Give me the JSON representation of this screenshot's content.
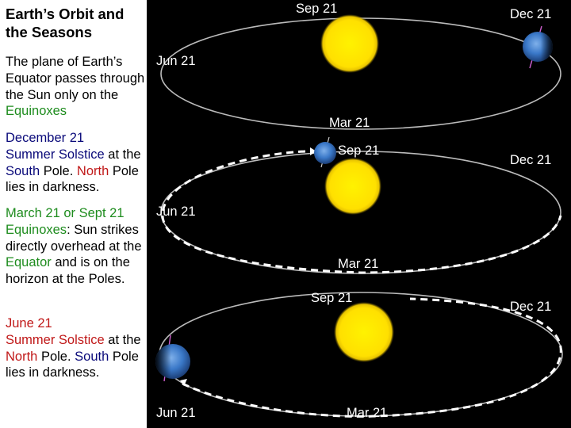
{
  "title": "Earth’s Orbit and the Seasons",
  "paragraphs": {
    "equator_plane": {
      "part1": "The plane of Earth’s Equator passes through the Sun only on the ",
      "equinoxes": "Equinoxes"
    },
    "december": {
      "date": "December 21",
      "solstice": "Summer Solstice",
      "at": " at the ",
      "pole": "South",
      "pole_suffix": " Pole. ",
      "dark_pole": "North",
      "dark_suffix": " Pole lies in darkness."
    },
    "equinox": {
      "date": "March 21 or Sept 21",
      "equinoxes": "Equinoxes",
      "text1": ": Sun strikes directly overhead at the ",
      "equator": "Equator",
      "text2": " and is on the horizon at the Poles."
    },
    "june": {
      "date": "June 21",
      "solstice": "Summer Solstice",
      "at": " at the ",
      "pole": "North",
      "pole_suffix": " Pole. ",
      "dark_pole": "South",
      "dark_suffix": " Pole lies in darkness."
    }
  },
  "colors": {
    "equinox_green": "#1e8c1e",
    "south_blue": "#0a0a7a",
    "north_red": "#c01818",
    "sun_yellow": "#ffe600",
    "earth_blue": "#3a78c8",
    "orbit_gray": "#bbbbbb",
    "background": "#000000"
  },
  "diagrams": [
    {
      "name": "december-solstice",
      "earth_position": "Dec 21",
      "labels": {
        "sep": "Sep 21",
        "dec": "Dec 21",
        "jun": "Jun 21",
        "mar": "Mar 21"
      }
    },
    {
      "name": "september-equinox",
      "earth_position": "Sep 21",
      "labels": {
        "sep": "Sep 21",
        "dec": "Dec 21",
        "jun": "Jun 21",
        "mar": "Mar 21"
      }
    },
    {
      "name": "june-solstice",
      "earth_position": "Jun 21",
      "labels": {
        "sep": "Sep 21",
        "dec": "Dec 21",
        "jun": "Jun 21",
        "mar": "Mar 21"
      }
    }
  ]
}
